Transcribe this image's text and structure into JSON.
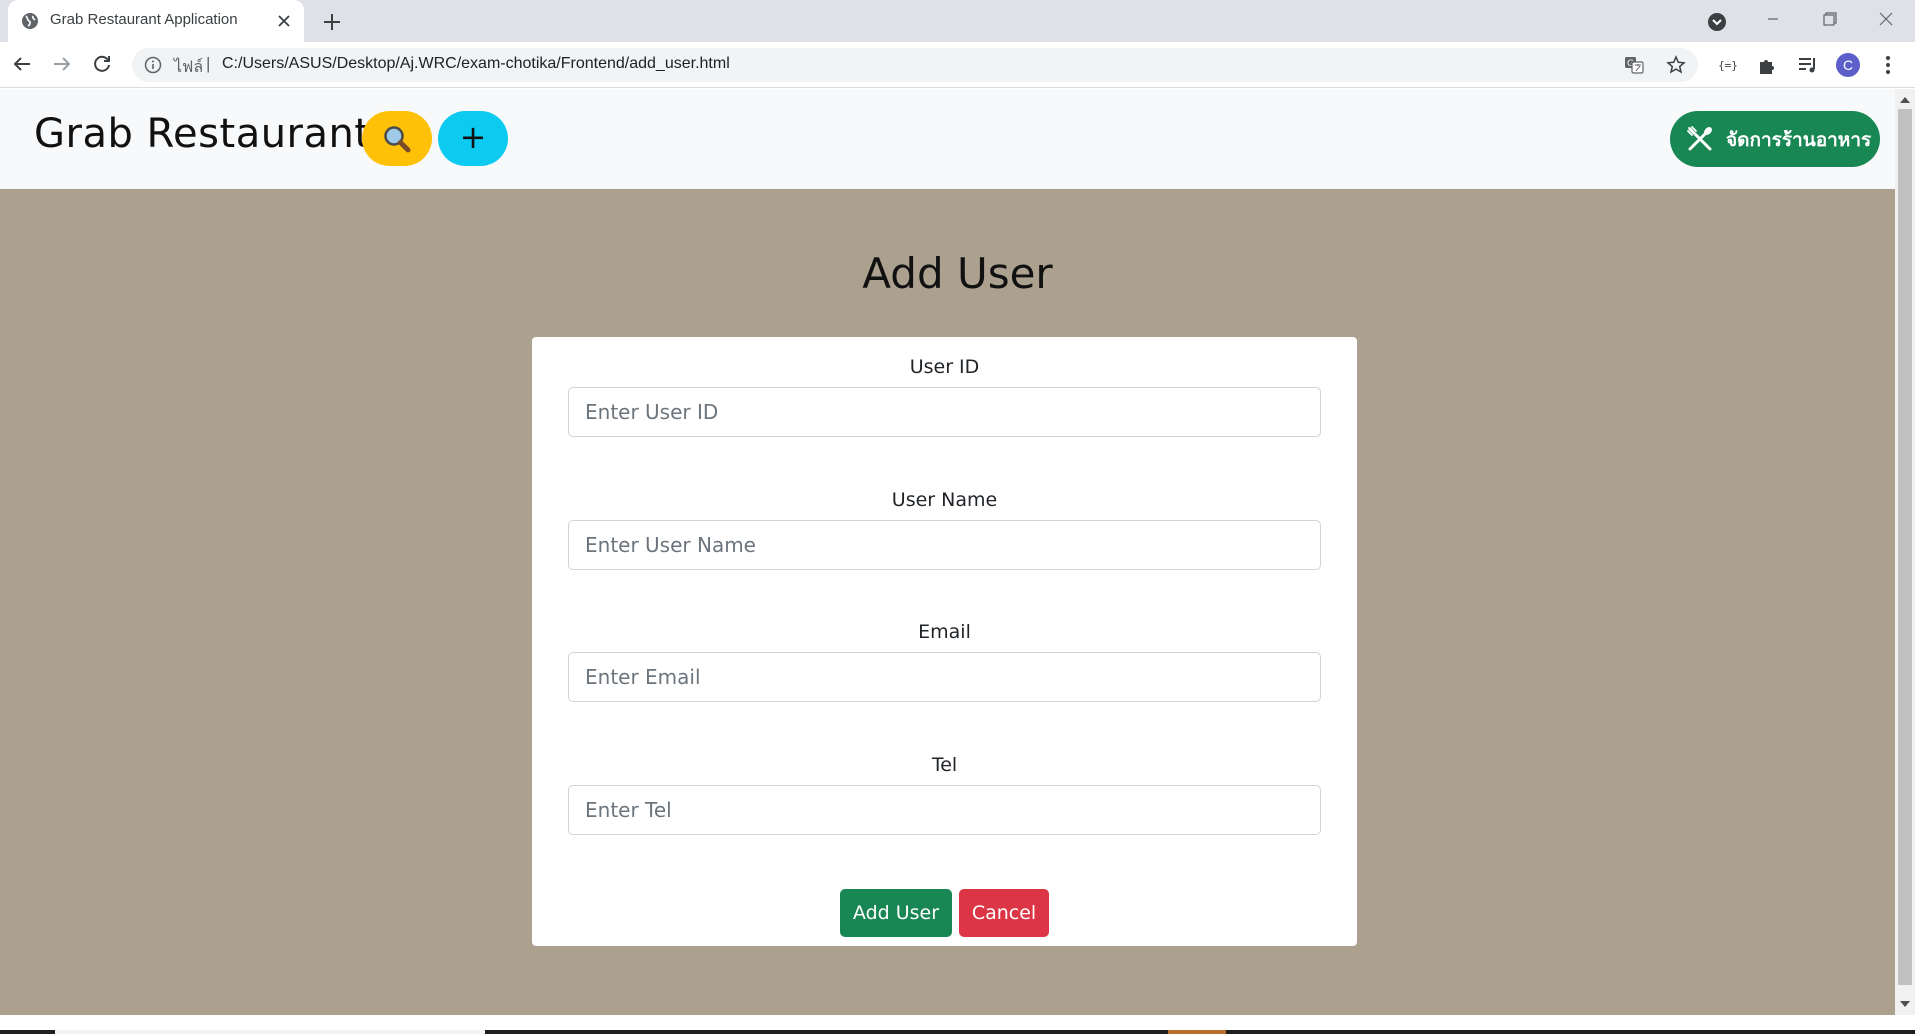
{
  "browser": {
    "tab_title": "Grab Restaurant Application",
    "url_scheme_label": "ไฟล์",
    "url_separator": "|",
    "url": "C:/Users/ASUS/Desktop/Aj.WRC/exam-chotika/Frontend/add_user.html",
    "profile_initial": "C"
  },
  "navbar": {
    "brand": "Grab Restaurant",
    "search_icon": "magnifier-icon",
    "add_label": "+",
    "manage_label": "จัดการร้านอาหาร",
    "manage_icon": "utensils-icon"
  },
  "colors": {
    "page_bg": "#aca08f",
    "search_btn": "#ffc107",
    "add_btn": "#0dcaf0",
    "success": "#198754",
    "danger": "#dc3545"
  },
  "page": {
    "title": "Add User"
  },
  "form": {
    "fields": [
      {
        "label": "User ID",
        "placeholder": "Enter User ID",
        "value": ""
      },
      {
        "label": "User Name",
        "placeholder": "Enter User Name",
        "value": ""
      },
      {
        "label": "Email",
        "placeholder": "Enter Email",
        "value": ""
      },
      {
        "label": "Tel",
        "placeholder": "Enter Tel",
        "value": ""
      }
    ],
    "submit_label": "Add User",
    "cancel_label": "Cancel"
  }
}
